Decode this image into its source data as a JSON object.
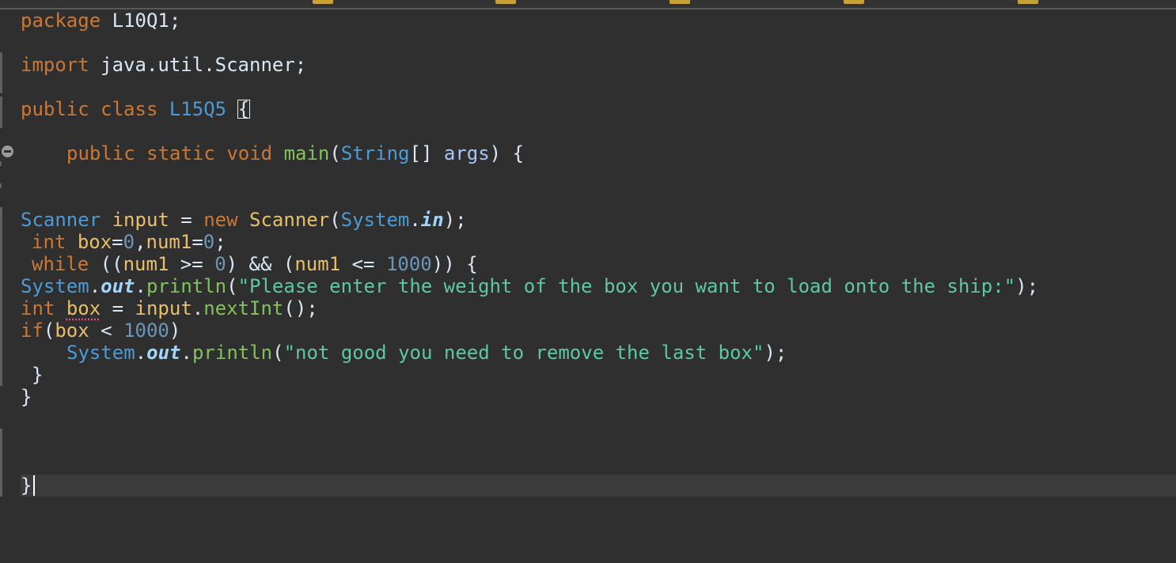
{
  "editor": {
    "top_strip_markers": [
      "marker",
      "marker",
      "marker",
      "marker",
      "marker",
      "marker"
    ],
    "icons": {
      "fold": "fold-collapse-icon"
    },
    "colors": {
      "background": "#2f2f2f",
      "keyword": "#cc7832",
      "class_name": "#4b9bd6",
      "string": "#5ec7a3",
      "number": "#6897bb",
      "method": "#7fc45a",
      "variable": "#e8bf6a",
      "warning_underline": "#e05080"
    },
    "code": {
      "line1": {
        "kw": "package",
        "name": "L10Q1;"
      },
      "line2": {
        "kw": "import",
        "name": "java.util.Scanner;"
      },
      "line3": {
        "kw1": "public",
        "kw2": "class",
        "cls": "L15Q5",
        "brace": "{"
      },
      "line4": {
        "kw1": "public",
        "kw2": "static",
        "kw3": "void",
        "meth": "main",
        "open": "(",
        "type": "String",
        "arr": "[] ",
        "param": "args",
        "close": ") {"
      },
      "line5": {
        "cls1": "Scanner",
        "var": "input",
        "eq": " = ",
        "kw": "new",
        "cls2": "Scanner",
        "open": "(",
        "sys": "System",
        "dot": ".",
        "field": "in",
        "close": ");"
      },
      "line6": {
        "kw": "int",
        "v1": "box",
        "eq1": "=",
        "n1": "0",
        "comma": ",",
        "v2": "num1",
        "eq2": "=",
        "n2": "0",
        "end": ";"
      },
      "line7": {
        "kw": "while",
        "p1": " ((",
        "v1": "num1",
        "op1": " >= ",
        "n1": "0",
        "p2": ") && (",
        "v2": "num1",
        "op2": " <= ",
        "n2": "1000",
        "p3": ")) {"
      },
      "line8": {
        "sys": "System",
        "dot1": ".",
        "field": "out",
        "dot2": ".",
        "meth": "println",
        "open": "(",
        "str": "\"Please enter the weight of the box you want to load onto the ship:\"",
        "close": ");"
      },
      "line9": {
        "kw": "int",
        "var": "box",
        "eq": " = ",
        "obj": "input",
        "dot": ".",
        "meth": "nextInt",
        "close": "();"
      },
      "line10": {
        "kw": "if",
        "open": "(",
        "var": "box",
        "op": " < ",
        "num": "1000",
        "close": ")"
      },
      "line11": {
        "sys": "System",
        "dot1": ".",
        "field": "out",
        "dot2": ".",
        "meth": "println",
        "open": "(",
        "str": "\"not good you need to remove the last box\"",
        "close": ");"
      },
      "line12": {
        "brace": "}"
      },
      "line13": {
        "brace": "}"
      },
      "line14": {
        "brace": "}"
      }
    }
  }
}
